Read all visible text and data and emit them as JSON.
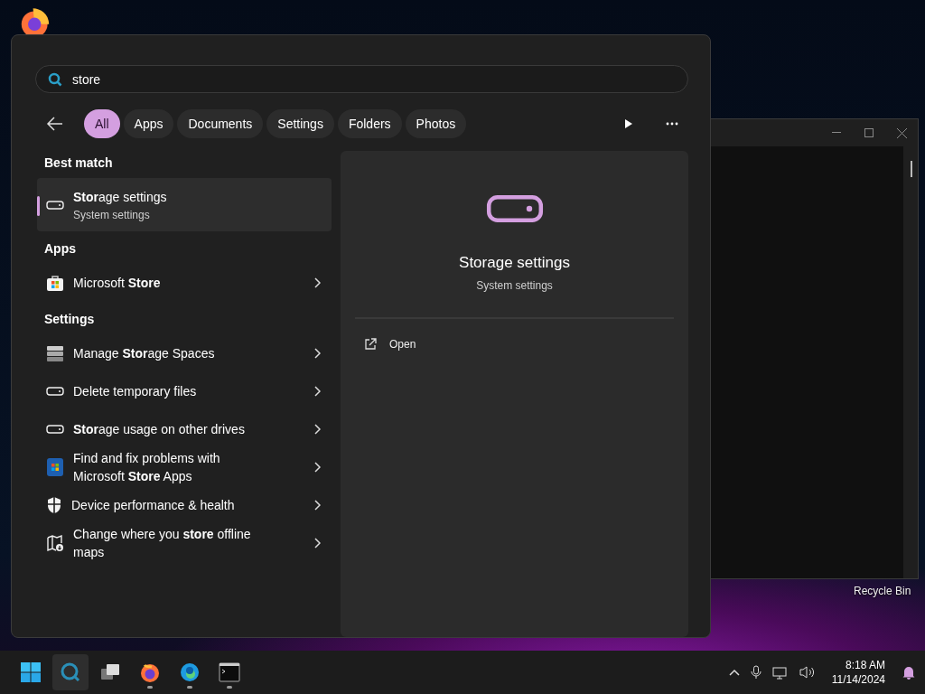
{
  "desktop": {
    "icon_label": "Recycle Bin"
  },
  "search": {
    "value": "store"
  },
  "filters": [
    {
      "label": "All",
      "selected": true
    },
    {
      "label": "Apps",
      "selected": false
    },
    {
      "label": "Documents",
      "selected": false
    },
    {
      "label": "Settings",
      "selected": false
    },
    {
      "label": "Folders",
      "selected": false
    },
    {
      "label": "Photos",
      "selected": false
    }
  ],
  "sections": [
    {
      "heading": "Best match",
      "items": [
        {
          "title": "**Stor**age settings",
          "subtitle": "System settings",
          "selected": true
        }
      ]
    },
    {
      "heading": "Apps",
      "items": [
        {
          "title": "Microsoft **Store**",
          "selected": false
        }
      ]
    },
    {
      "heading": "Settings",
      "items": [
        {
          "title": "Manage **Stor**age Spaces",
          "selected": false
        },
        {
          "title": "Delete temporary files",
          "selected": false
        },
        {
          "title": "**Stor**age usage on other drives",
          "selected": false
        },
        {
          "title": "Find and fix problems with Microsoft **Store** Apps",
          "selected": false
        },
        {
          "title": "Device performance & health",
          "selected": false
        },
        {
          "title": "Change where you **store** offline maps",
          "selected": false
        }
      ]
    }
  ],
  "preview": {
    "title": "Storage settings",
    "subtitle": "System settings",
    "actions": [
      {
        "label": "Open"
      }
    ]
  },
  "taskbar": {
    "apps": [
      {
        "running": false
      },
      {
        "running": false
      },
      {
        "running": false
      },
      {
        "running": true
      },
      {
        "running": true
      },
      {
        "running": true
      }
    ],
    "time": "8:18 AM",
    "date": "11/14/2024"
  }
}
